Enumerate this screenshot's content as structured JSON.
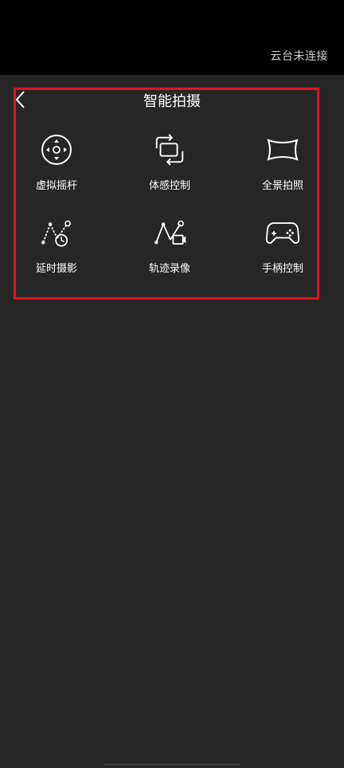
{
  "status_bar": {
    "gimbal_status": "云台未连接"
  },
  "header": {
    "title": "智能拍摄",
    "back_icon": "chevron-left-icon"
  },
  "features": [
    {
      "label": "虚拟摇杆",
      "icon": "joystick-icon"
    },
    {
      "label": "体感控制",
      "icon": "motion-rotate-icon"
    },
    {
      "label": "全景拍照",
      "icon": "panorama-icon"
    },
    {
      "label": "延时摄影",
      "icon": "timelapse-icon"
    },
    {
      "label": "轨迹录像",
      "icon": "trajectory-video-icon"
    },
    {
      "label": "手柄控制",
      "icon": "gamepad-icon"
    }
  ],
  "colors": {
    "background": "#262626",
    "top_bar": "#000000",
    "highlight_border": "#e0141e"
  }
}
